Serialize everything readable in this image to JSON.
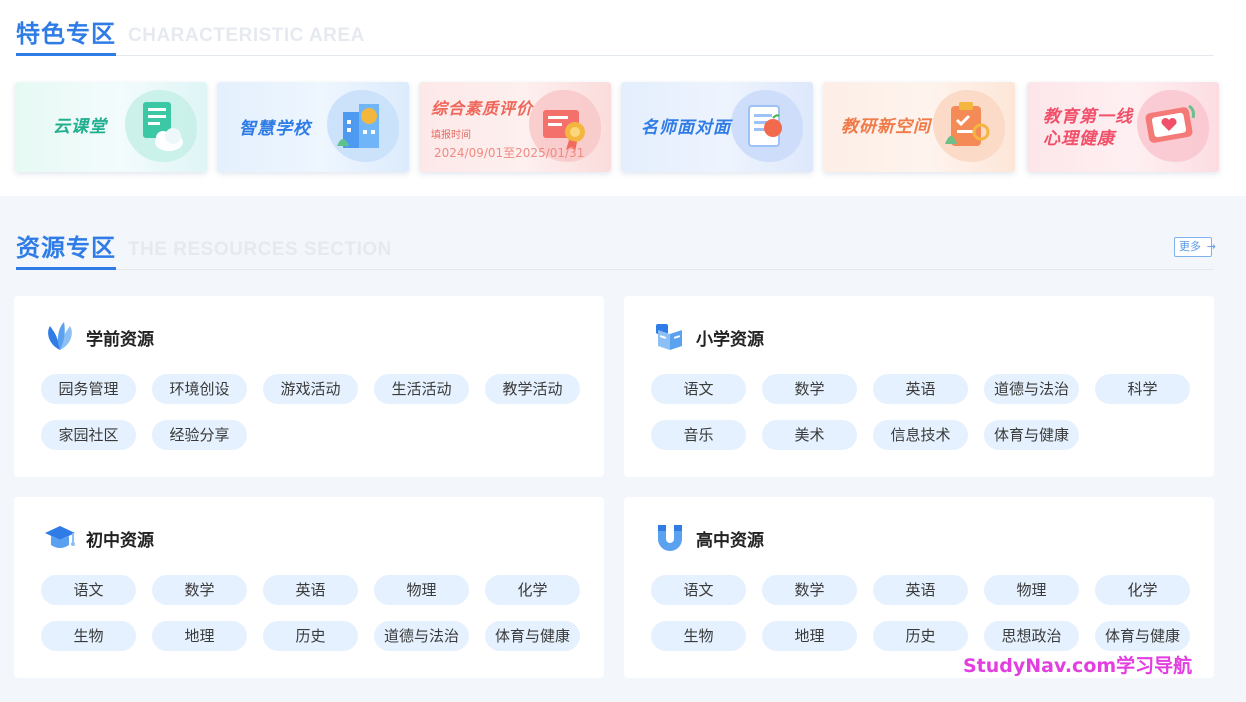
{
  "featured": {
    "title_zh": "特色专区",
    "title_en": "CHARACTERISTIC AREA",
    "cards": [
      {
        "label": "云课堂",
        "color": "#22b795"
      },
      {
        "label": "智慧学校",
        "color": "#2f7ce6"
      },
      {
        "label": "综合素质评价",
        "color": "#f0665a",
        "sub_label": "填报时间",
        "sub_value": "2024/09/01至2025/01/31"
      },
      {
        "label": "名师面对面",
        "color": "#2f7ce6"
      },
      {
        "label": "教研新空间",
        "color": "#f07a48"
      },
      {
        "label": "教育第一线",
        "label2": "心理健康",
        "color": "#f0506a"
      }
    ]
  },
  "resources": {
    "title_zh": "资源专区",
    "title_en": "THE RESOURCES SECTION",
    "more_label": "更多",
    "preschool": {
      "title": "学前资源",
      "tags": [
        "园务管理",
        "环境创设",
        "游戏活动",
        "生活活动",
        "教学活动",
        "家园社区",
        "经验分享"
      ]
    },
    "primary": {
      "title": "小学资源",
      "tags": [
        "语文",
        "数学",
        "英语",
        "道德与法治",
        "科学",
        "音乐",
        "美术",
        "信息技术",
        "体育与健康"
      ]
    },
    "junior": {
      "title": "初中资源",
      "tags": [
        "语文",
        "数学",
        "英语",
        "物理",
        "化学",
        "生物",
        "地理",
        "历史",
        "道德与法治",
        "体育与健康"
      ]
    },
    "senior": {
      "title": "高中资源",
      "tags": [
        "语文",
        "数学",
        "英语",
        "物理",
        "化学",
        "生物",
        "地理",
        "历史",
        "思想政治",
        "体育与健康"
      ]
    }
  },
  "watermark": "StudyNav.com学习导航"
}
